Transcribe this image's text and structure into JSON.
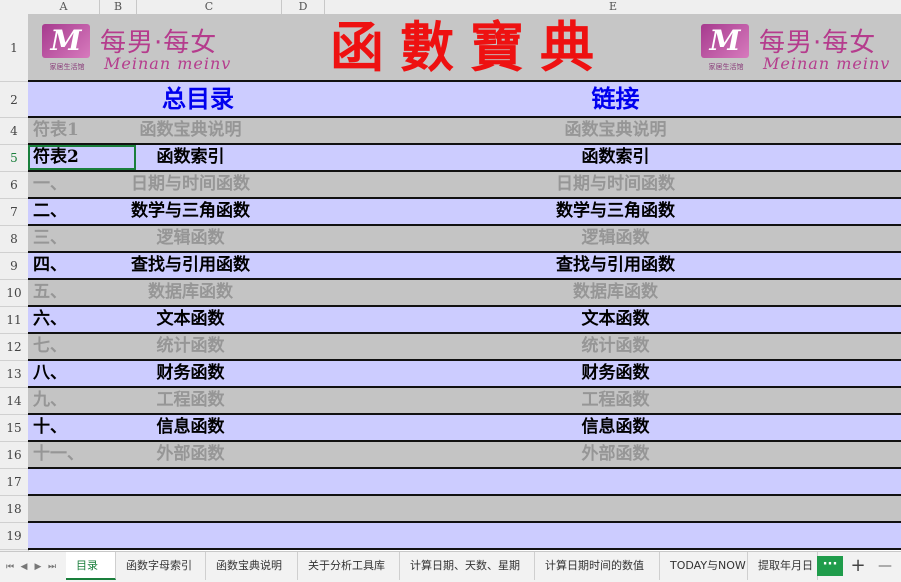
{
  "columns": [
    "A",
    "B",
    "C",
    "D",
    "E"
  ],
  "rows": [
    "1",
    "2",
    "4",
    "5",
    "6",
    "7",
    "8",
    "9",
    "10",
    "11",
    "12",
    "13",
    "14",
    "15",
    "16",
    "17",
    "18",
    "19"
  ],
  "banner": {
    "title": "函數寶典",
    "logo_left": {
      "mark": "M",
      "cn": "每男·每女",
      "en": "Meinan meinv",
      "tiny": "家居生活馆"
    },
    "logo_right": {
      "mark": "M",
      "cn": "每男·每女",
      "en": "Meinan meinv",
      "tiny": "家居生活馆"
    }
  },
  "header": {
    "left": "总目录",
    "right": "链接"
  },
  "entries": [
    {
      "a": "符表1",
      "b": "函数宝典说明",
      "e": "函数宝典说明",
      "style": "gray"
    },
    {
      "a": "符表2",
      "b": "函数索引",
      "e": "函数索引",
      "style": "lav"
    },
    {
      "a": "一、",
      "b": "日期与时间函数",
      "e": "日期与时间函数",
      "style": "gray"
    },
    {
      "a": "二、",
      "b": "数学与三角函数",
      "e": "数学与三角函数",
      "style": "lav"
    },
    {
      "a": "三、",
      "b": "逻辑函数",
      "e": "逻辑函数",
      "style": "gray"
    },
    {
      "a": "四、",
      "b": "查找与引用函数",
      "e": "查找与引用函数",
      "style": "lav"
    },
    {
      "a": "五、",
      "b": "数据库函数",
      "e": "数据库函数",
      "style": "gray"
    },
    {
      "a": "六、",
      "b": "文本函数",
      "e": "文本函数",
      "style": "lav"
    },
    {
      "a": "七、",
      "b": "统计函数",
      "e": "统计函数",
      "style": "gray"
    },
    {
      "a": "八、",
      "b": "财务函数",
      "e": "财务函数",
      "style": "lav"
    },
    {
      "a": "九、",
      "b": "工程函数",
      "e": "工程函数",
      "style": "gray"
    },
    {
      "a": "十、",
      "b": "信息函数",
      "e": "信息函数",
      "style": "lav"
    },
    {
      "a": "十一、",
      "b": "外部函数",
      "e": "外部函数",
      "style": "gray"
    },
    {
      "a": "",
      "b": "",
      "e": "",
      "style": "lav"
    },
    {
      "a": "",
      "b": "",
      "e": "",
      "style": "gray"
    },
    {
      "a": "",
      "b": "",
      "e": "",
      "style": "lav"
    }
  ],
  "sheet_tabs": [
    "目录",
    "函数字母索引",
    "函数宝典说明",
    "关于分析工具库",
    "计算日期、天数、星期",
    "计算日期时间的数值",
    "TODAY与NOW",
    "提取年月日"
  ],
  "active_tab": "目录",
  "more_label": "···",
  "add_label": "+",
  "minimize_label": "—",
  "colors": {
    "gray_row": "#c4c4c4",
    "lavender_row": "#ccccff",
    "title_red": "#ee1111",
    "header_blue": "#0000ee",
    "accent_green": "#1f9c4b"
  }
}
